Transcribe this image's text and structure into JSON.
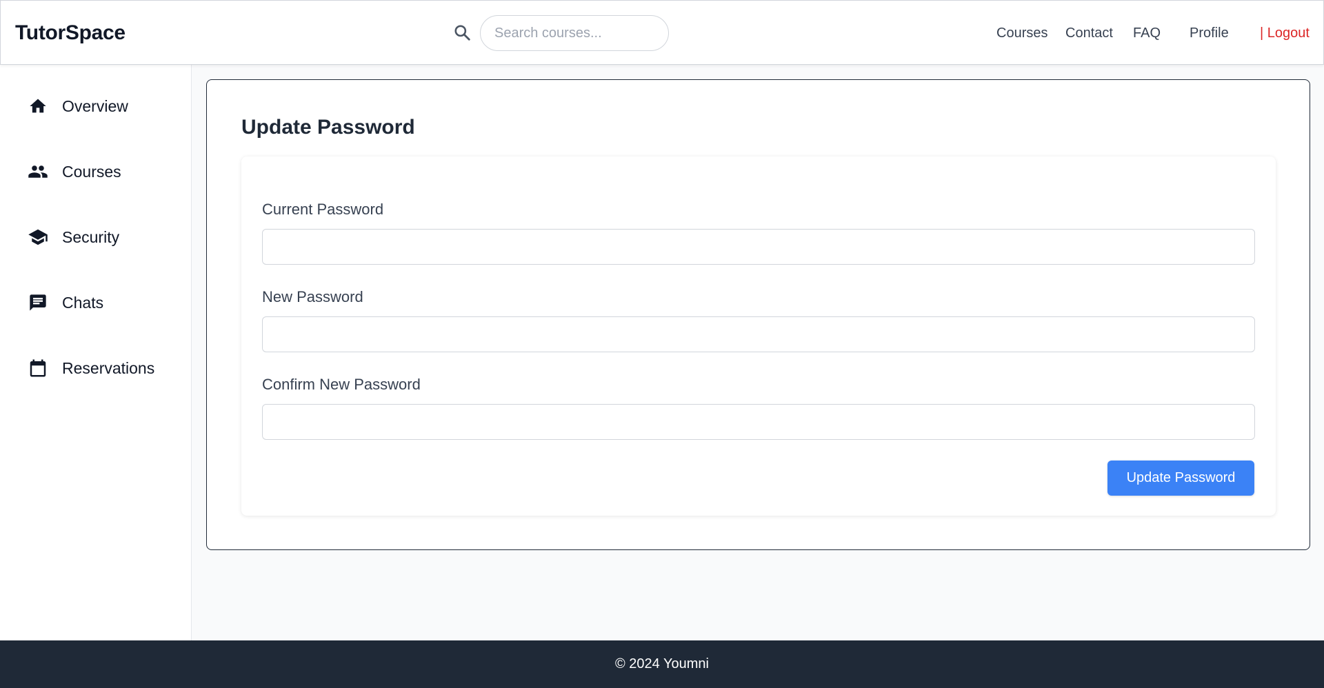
{
  "header": {
    "logo": "TutorSpace",
    "search": {
      "placeholder": "Search courses...",
      "value": ""
    },
    "nav": [
      {
        "label": "Courses"
      },
      {
        "label": "Contact"
      },
      {
        "label": "FAQ"
      },
      {
        "label": "Profile"
      },
      {
        "label": "| Logout"
      }
    ]
  },
  "sidebar": {
    "items": [
      {
        "label": "Overview",
        "icon": "home-icon"
      },
      {
        "label": "Courses",
        "icon": "people-icon"
      },
      {
        "label": "Security",
        "icon": "graduation-cap-icon"
      },
      {
        "label": "Chats",
        "icon": "chat-icon"
      },
      {
        "label": "Reservations",
        "icon": "calendar-icon"
      }
    ]
  },
  "main": {
    "title": "Update Password",
    "form": {
      "fields": [
        {
          "label": "Current Password",
          "value": ""
        },
        {
          "label": "New Password",
          "value": ""
        },
        {
          "label": "Confirm New Password",
          "value": ""
        }
      ],
      "submit_label": "Update Password"
    }
  },
  "footer": {
    "text": "© 2024 Youmni"
  },
  "colors": {
    "accent": "#3b82f6",
    "logout": "#dc2626",
    "footer_bg": "#1f2937"
  }
}
